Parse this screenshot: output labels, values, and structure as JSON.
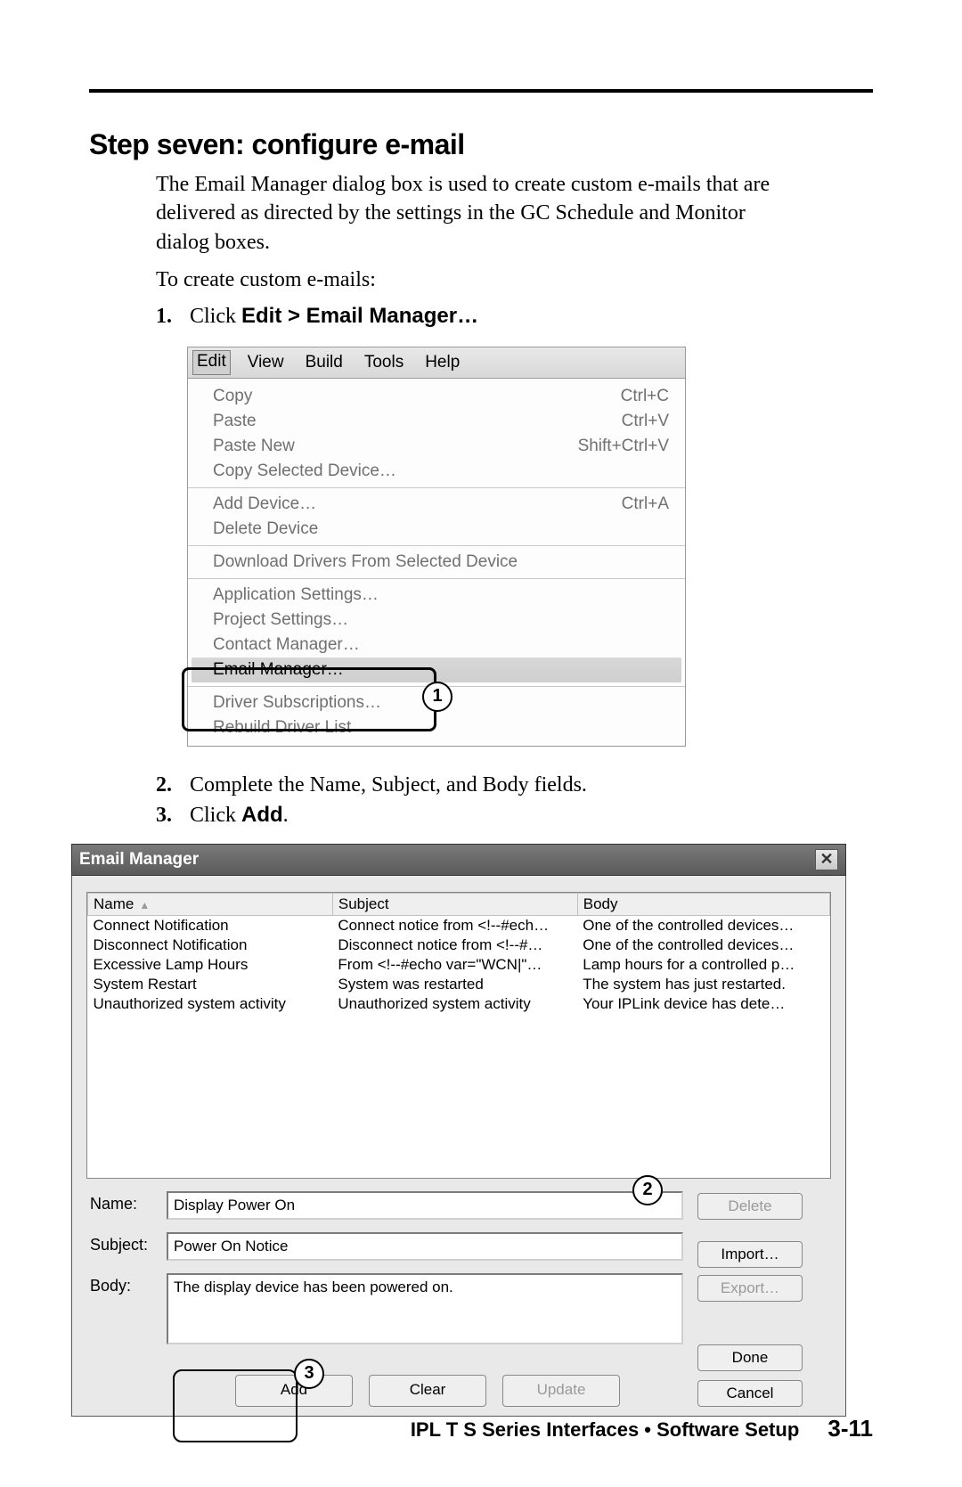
{
  "heading": "Step seven: configure e-mail",
  "intro_p1": "The Email Manager dialog box is used to create custom e-mails that are delivered as directed by the settings in the GC Schedule and Monitor dialog boxes.",
  "intro_p2": "To create custom e-mails:",
  "step1": {
    "num": "1.",
    "pre": "Click ",
    "bold": "Edit > Email Manager…"
  },
  "step2": {
    "num": "2.",
    "txt": "Complete the Name, Subject, and Body fields."
  },
  "step3": {
    "num": "3.",
    "pre": "Click ",
    "bold": "Add",
    "post": "."
  },
  "menubar": {
    "edit": "Edit",
    "view": "View",
    "build": "Build",
    "tools": "Tools",
    "help": "Help"
  },
  "menu_items": {
    "copy": {
      "label": "Copy",
      "short": "Ctrl+C"
    },
    "paste": {
      "label": "Paste",
      "short": "Ctrl+V"
    },
    "paste_new": {
      "label": "Paste New",
      "short": "Shift+Ctrl+V"
    },
    "copy_sel": {
      "label": "Copy Selected Device…"
    },
    "add_dev": {
      "label": "Add Device…",
      "short": "Ctrl+A"
    },
    "del_dev": {
      "label": "Delete Device"
    },
    "dl_drivers": {
      "label": "Download Drivers From Selected Device"
    },
    "app_set": {
      "label": "Application Settings…"
    },
    "proj_set": {
      "label": "Project Settings…"
    },
    "contact_mgr": {
      "label": "Contact Manager…"
    },
    "email_mgr": {
      "label": "Email Manager…"
    },
    "driver_sub": {
      "label": "Driver Subscriptions…"
    },
    "rebuild": {
      "label": "Rebuild Driver List"
    }
  },
  "callout1": "1",
  "dialog": {
    "title": "Email Manager",
    "columns": {
      "name": "Name",
      "subject": "Subject",
      "body": "Body"
    },
    "rows": [
      {
        "name": "Connect Notification",
        "subject": "Connect notice from <!--#ech…",
        "body": "One of the controlled devices…"
      },
      {
        "name": "Disconnect Notification",
        "subject": "Disconnect notice from <!--#…",
        "body": "One of the controlled devices…"
      },
      {
        "name": "Excessive Lamp Hours",
        "subject": "From <!--#echo var=\"WCN|\"…",
        "body": "Lamp hours for a controlled p…"
      },
      {
        "name": "System Restart",
        "subject": "System was restarted",
        "body": "The system has just restarted."
      },
      {
        "name": "Unauthorized system activity",
        "subject": "Unauthorized system activity",
        "body": "Your IPLink device has dete…"
      }
    ],
    "labels": {
      "name": "Name:",
      "subject": "Subject:",
      "body": "Body:"
    },
    "fields": {
      "name_val": "Display Power On",
      "subject_val": "Power On Notice",
      "body_val": "The display device has been powered on."
    },
    "buttons": {
      "delete": "Delete",
      "import": "Import…",
      "export": "Export…",
      "add": "Add",
      "clear": "Clear",
      "update": "Update",
      "done": "Done",
      "cancel": "Cancel"
    }
  },
  "callout2": "2",
  "callout3": "3",
  "footer_title": "IPL T S Series Interfaces • Software Setup",
  "footer_page": "3-11"
}
